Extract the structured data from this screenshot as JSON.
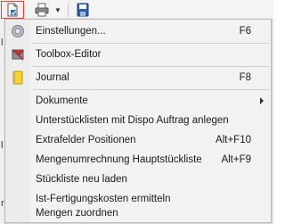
{
  "toolbar": {
    "buttons": [
      {
        "icon": "page-setup-icon",
        "active": true
      },
      {
        "icon": "printer-icon"
      },
      {
        "icon": "dropdown-arrow-icon"
      },
      {
        "icon": "save-disk-icon"
      }
    ]
  },
  "menu": {
    "items": [
      {
        "label": "Einstellungen...",
        "shortcut": "F6",
        "icon": "gear-icon"
      },
      {
        "label": "Toolbox-Editor",
        "shortcut": "",
        "icon": "toolbox-editor-icon"
      },
      {
        "label": "Journal",
        "shortcut": "F8",
        "icon": "journal-icon"
      },
      {
        "label": "Dokumente",
        "shortcut": "",
        "submenu": true
      },
      {
        "label": "Unterstücklisten mit Dispo Auftrag anlegen",
        "shortcut": ""
      },
      {
        "label": "Extrafelder Positionen",
        "shortcut": "Alt+F10"
      },
      {
        "label": "Mengenumrechnung Hauptstückliste",
        "shortcut": "Alt+F9"
      },
      {
        "label": "Stückliste neu laden",
        "shortcut": ""
      },
      {
        "label": "Ist-Fertigungskosten ermitteln",
        "shortcut": ""
      },
      {
        "label": "Mengen zuordnen",
        "shortcut": ""
      }
    ]
  },
  "colors": {
    "active_border": "#e0463c",
    "menu_bg": "#f2f2f2",
    "separator": "#d0d0d0"
  }
}
